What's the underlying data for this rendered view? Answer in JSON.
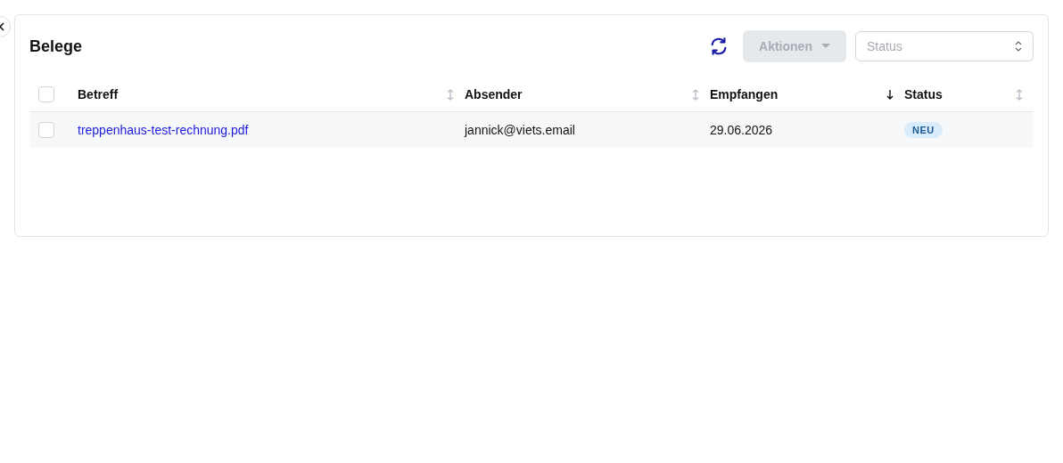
{
  "title": "Belege",
  "toolbar": {
    "actions_button": {
      "label": "Aktionen",
      "disabled": true
    },
    "status_select": {
      "placeholder": "Status"
    }
  },
  "table": {
    "select_all": {
      "checked": false
    },
    "columns": [
      {
        "label": "Betreff",
        "sorted": false
      },
      {
        "label": "Absender",
        "sorted": false
      },
      {
        "label": "Empfangen",
        "sorted": true
      },
      {
        "label": "Status",
        "sorted": false
      }
    ],
    "rows": [
      {
        "checked": false,
        "subject": "treppenhaus-test-rechnung.pdf",
        "sender": "jannick@viets.email",
        "received": "29.06.2026",
        "status": "NEU"
      }
    ]
  }
}
